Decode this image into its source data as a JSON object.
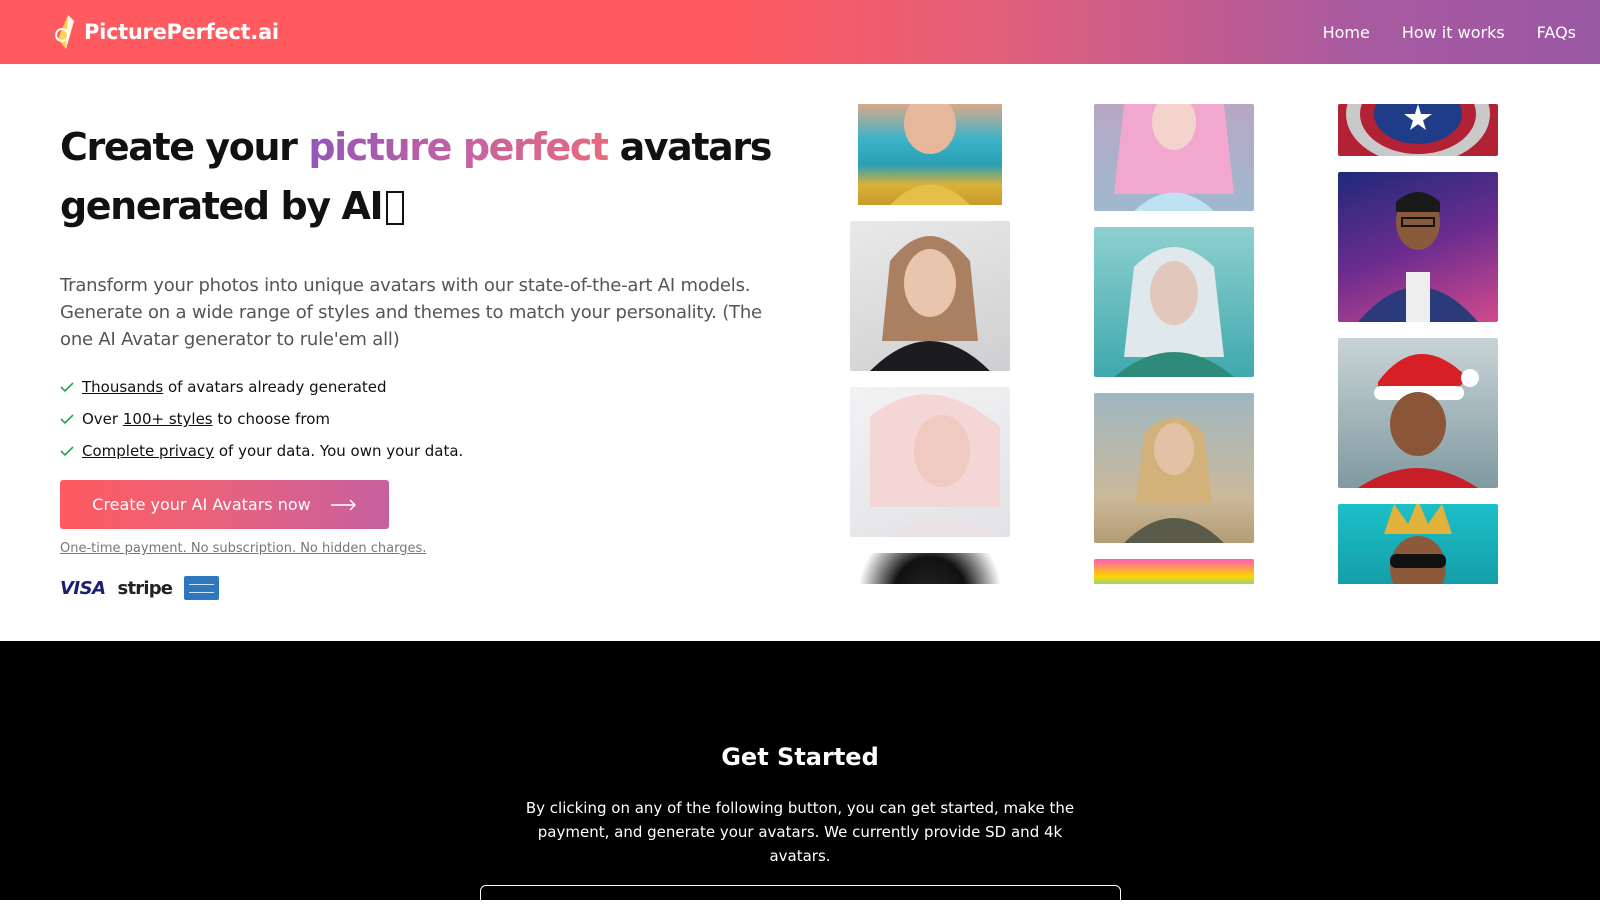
{
  "header": {
    "brand": "PicturePerfect.ai",
    "nav": [
      {
        "label": "Home"
      },
      {
        "label": "How it works"
      },
      {
        "label": "FAQs"
      }
    ]
  },
  "hero": {
    "title_part1": "Create your ",
    "title_highlight": "picture perfect",
    "title_part2": " avatars generated by AI",
    "subtitle": "Transform your photos into unique avatars with our state-of-the-art AI models. Generate on a wide range of styles and themes to match your personality. (The one AI Avatar generator to rule'em all)",
    "features": [
      {
        "link": "Thousands",
        "prefix": "",
        "suffix": " of avatars already generated"
      },
      {
        "link": "100+ styles",
        "prefix": "Over ",
        "suffix": " to choose from"
      },
      {
        "link": "Complete privacy",
        "prefix": "",
        "suffix": " of your data. You own your data."
      }
    ],
    "cta_label": "Create your AI Avatars now",
    "note": "One-time payment. No subscription. No hidden charges.",
    "payments": {
      "visa": "VISA",
      "stripe": "stripe"
    }
  },
  "get_started": {
    "title": "Get Started",
    "text": "By clicking on any of the following button, you can get started, make the payment, and generate your avatars. We currently provide SD and 4k avatars."
  },
  "gallery": {
    "columns": [
      [
        "portrait-gold-dress",
        "portrait-business-woman",
        "portrait-blonde-woman",
        "portrait-bw-woman"
      ],
      [
        "portrait-pink-hair-fairy",
        "portrait-silver-hair-queen",
        "portrait-elf-warrior",
        "portrait-rainbow"
      ],
      [
        "portrait-captain-shield",
        "portrait-cyberpunk-man",
        "portrait-santa-hat",
        "portrait-king-sunglasses"
      ]
    ]
  },
  "colors": {
    "header_start": "#ff5a5f",
    "header_end": "#9a58a4",
    "accent_purple": "#9157b8",
    "check_green": "#2e9e5b"
  }
}
